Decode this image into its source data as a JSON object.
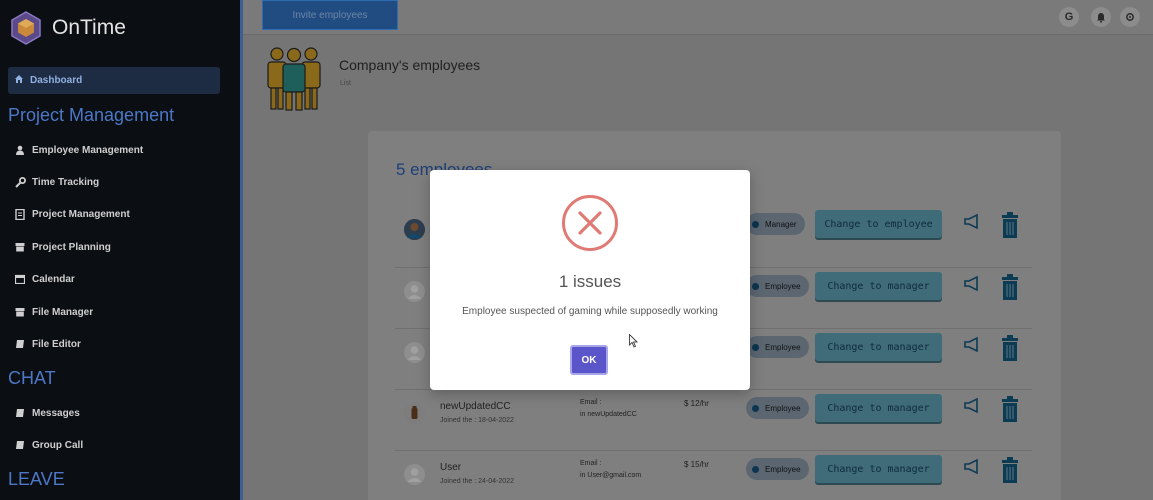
{
  "app": {
    "name": "OnTime"
  },
  "sidebar": {
    "active_item": "Dashboard",
    "sections": [
      {
        "title": "Project Management"
      },
      {
        "title": "CHAT"
      },
      {
        "title": "LEAVE"
      }
    ],
    "items": [
      {
        "label": "Employee Management",
        "icon": "user-icon"
      },
      {
        "label": "Time Tracking",
        "icon": "wrench-icon"
      },
      {
        "label": "Project Management",
        "icon": "notebook-icon"
      },
      {
        "label": "Project Planning",
        "icon": "archive-icon"
      },
      {
        "label": "Calendar",
        "icon": "calendar-icon"
      },
      {
        "label": "File Manager",
        "icon": "archive-icon"
      },
      {
        "label": "File Editor",
        "icon": "book-icon"
      },
      {
        "label": "Messages",
        "icon": "book-icon"
      },
      {
        "label": "Group Call",
        "icon": "book-icon"
      }
    ]
  },
  "topbar": {
    "invite_label": "Invite employees",
    "avatar_letter": "G",
    "icons": [
      "bell-icon",
      "settings-icon"
    ]
  },
  "page": {
    "title": "Company's employees",
    "subtitle": "List",
    "count_label": "5 employees"
  },
  "employees": [
    {
      "name": "",
      "joined": "",
      "email_label": "",
      "email": "",
      "rate": "",
      "role": "Manager",
      "action": "Change to employee"
    },
    {
      "name": "",
      "joined": "",
      "email_label": "",
      "email": "",
      "rate": "",
      "role": "Employee",
      "action": "Change to manager"
    },
    {
      "name": "",
      "joined": "",
      "email_label": "",
      "email": "",
      "rate": "",
      "role": "Employee",
      "action": "Change to manager"
    },
    {
      "name": "newUpdatedCC",
      "joined": "Joined the : 18-04-2022",
      "email_label": "Email :",
      "email": "in newUpdatedCC",
      "rate": "$ 12/hr",
      "role": "Employee",
      "action": "Change to manager"
    },
    {
      "name": "User",
      "joined": "Joined the : 24-04-2022",
      "email_label": "Email :",
      "email": "in User@gmail.com",
      "rate": "$ 15/hr",
      "role": "Employee",
      "action": "Change to manager"
    }
  ],
  "modal": {
    "title": "1 issues",
    "message": "Employee suspected of gaming while supposedly working",
    "ok_label": "OK",
    "icon": "error-x-icon"
  },
  "colors": {
    "accent": "#5a56c9",
    "error": "#d9534f",
    "sidebar_bg": "#0b0e12",
    "section_title": "#4c78c7"
  }
}
